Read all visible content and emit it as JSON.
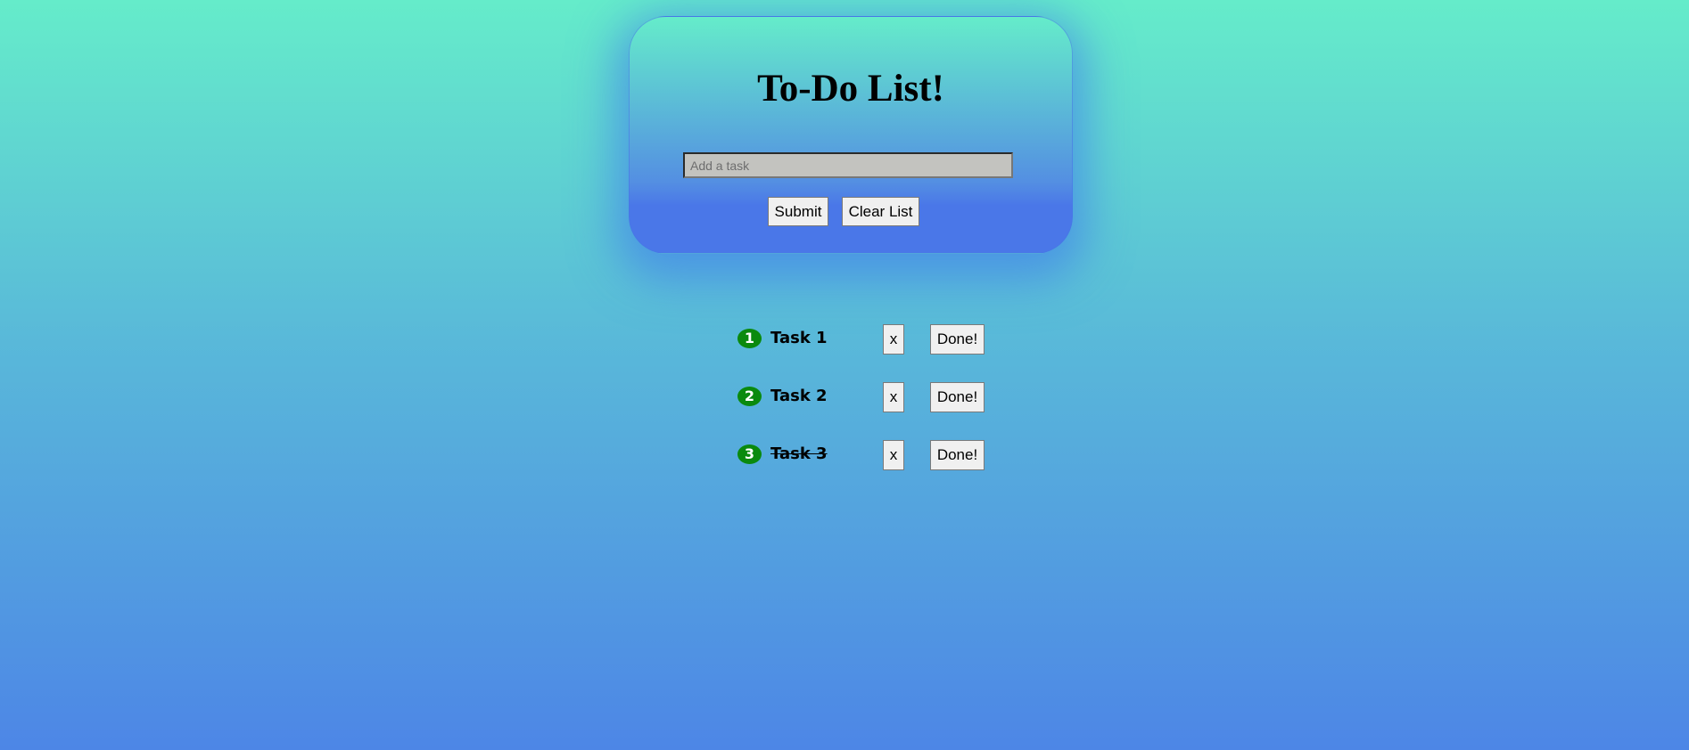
{
  "header": {
    "title": "To-Do List!"
  },
  "input": {
    "placeholder": "Add a task",
    "value": ""
  },
  "actions": {
    "submit_label": "Submit",
    "clear_label": "Clear List"
  },
  "tasks": [
    {
      "number": "1",
      "name": "Task 1",
      "completed": false,
      "delete_label": "x",
      "done_label": "Done!"
    },
    {
      "number": "2",
      "name": "Task 2",
      "completed": false,
      "delete_label": "x",
      "done_label": "Done!"
    },
    {
      "number": "3",
      "name": "Task 3",
      "completed": true,
      "delete_label": "x",
      "done_label": "Done!"
    }
  ],
  "colors": {
    "background_top": "#65ecca",
    "background_bottom": "#4d86e6",
    "badge": "#0a8a0e",
    "input_bg": "#c3c3bf"
  }
}
